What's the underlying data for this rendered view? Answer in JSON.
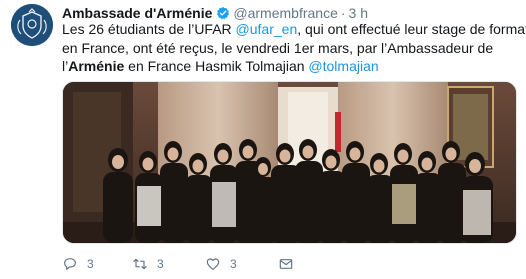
{
  "author": {
    "display_name": "Ambassade d'Arménie",
    "handle": "@armembfrance",
    "separator": "·",
    "time": "3 h",
    "avatar_icon": "coat-of-arms-icon",
    "verified_icon": "verified-badge-icon"
  },
  "tweet": {
    "line1_a": "Les 26 étudiants de l’UFAR ",
    "line1_mention": "@ufar_en",
    "line1_b": ", qui ont effectué leur stage de formation",
    "line2": "en France, ont été reçus, le vendredi 1er mars, par l’Ambassadeur de",
    "line3_a": "l’",
    "line3_bold": "Arménie",
    "line3_b": " en France Hasmik Tolmajian ",
    "line3_mention": "@tolmajian"
  },
  "media": {
    "kind": "group-photo"
  },
  "actions": {
    "reply_count": "3",
    "retweet_count": "3",
    "like_count": "3",
    "reply_icon": "reply-icon",
    "retweet_icon": "retweet-icon",
    "like_icon": "heart-icon",
    "message_icon": "direct-message-icon"
  },
  "colors": {
    "link": "#1b95e0",
    "muted": "#657786",
    "text": "#14171a",
    "verified": "#1da1f2"
  }
}
